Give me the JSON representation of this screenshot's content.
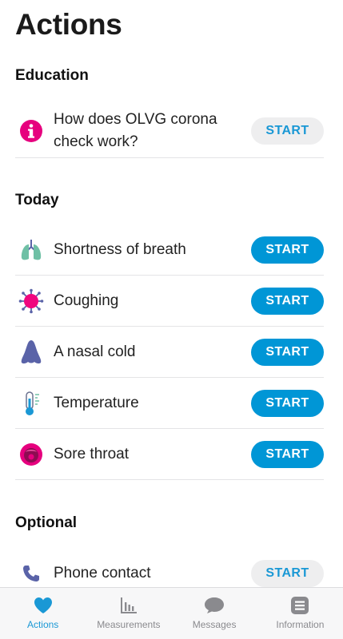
{
  "header": {
    "title": "Actions"
  },
  "sections": {
    "education": {
      "heading": "Education",
      "items": [
        {
          "label": "How does OLVG corona check work?",
          "button": "START",
          "icon": "info-icon"
        }
      ]
    },
    "today": {
      "heading": "Today",
      "items": [
        {
          "label": "Shortness of breath",
          "button": "START",
          "icon": "lungs-icon"
        },
        {
          "label": "Coughing",
          "button": "START",
          "icon": "virus-icon"
        },
        {
          "label": "A nasal cold",
          "button": "START",
          "icon": "nose-icon"
        },
        {
          "label": "Temperature",
          "button": "START",
          "icon": "thermometer-icon"
        },
        {
          "label": "Sore throat",
          "button": "START",
          "icon": "throat-icon"
        }
      ]
    },
    "optional": {
      "heading": "Optional",
      "items": [
        {
          "label": "Phone contact",
          "button": "START",
          "icon": "phone-icon"
        }
      ]
    }
  },
  "tabbar": {
    "tabs": [
      {
        "label": "Actions",
        "icon": "heart-icon",
        "active": true
      },
      {
        "label": "Measurements",
        "icon": "bar-chart-icon",
        "active": false
      },
      {
        "label": "Messages",
        "icon": "chat-bubble-icon",
        "active": false
      },
      {
        "label": "Information",
        "icon": "list-icon",
        "active": false
      }
    ]
  },
  "colors": {
    "accent": "#0096d6",
    "accent_text": "#1a98d5",
    "magenta": "#e6007e",
    "teal": "#5fb8a0",
    "indigo": "#5a63a8"
  }
}
